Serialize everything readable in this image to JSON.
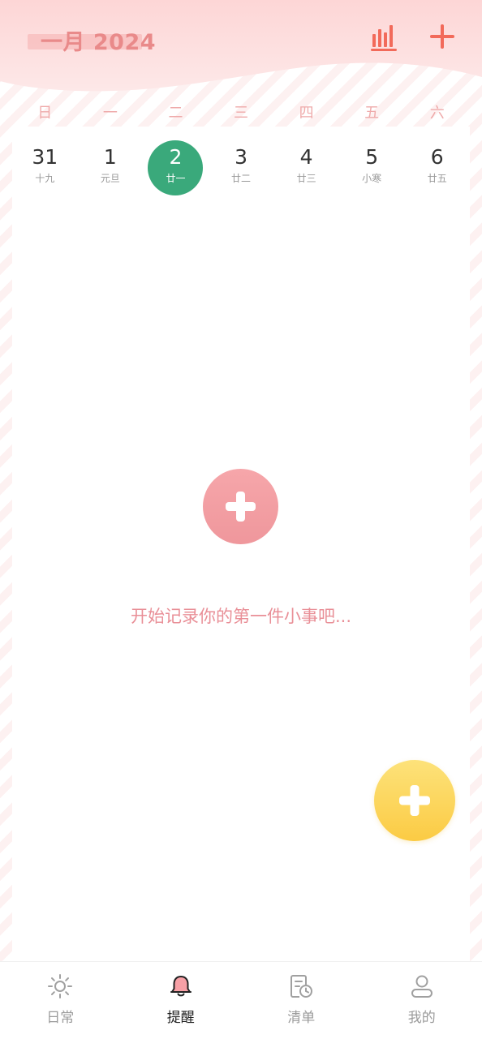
{
  "header": {
    "month_title": "一月 2024",
    "colors": {
      "accent": "#e98a8a",
      "icon": "#f26a5a",
      "wave": "#fde1e1"
    }
  },
  "weekdays": [
    "日",
    "一",
    "二",
    "三",
    "四",
    "五",
    "六"
  ],
  "dates": [
    {
      "day": "31",
      "lunar": "十九",
      "selected": false
    },
    {
      "day": "1",
      "lunar": "元旦",
      "selected": false
    },
    {
      "day": "2",
      "lunar": "廿一",
      "selected": true
    },
    {
      "day": "3",
      "lunar": "廿二",
      "selected": false
    },
    {
      "day": "4",
      "lunar": "廿三",
      "selected": false
    },
    {
      "day": "5",
      "lunar": "小寒",
      "selected": false
    },
    {
      "day": "6",
      "lunar": "廿五",
      "selected": false
    }
  ],
  "empty_state": {
    "message": "开始记录你的第一件小事吧...",
    "icon": "plus-icon",
    "color": "#f29fa4"
  },
  "fab": {
    "icon": "plus-icon",
    "color": "#fcd55a"
  },
  "tabbar": {
    "tabs": [
      {
        "label": "日常",
        "icon": "sun-icon",
        "active": false
      },
      {
        "label": "提醒",
        "icon": "bell-icon",
        "active": true
      },
      {
        "label": "清单",
        "icon": "list-clock-icon",
        "active": false
      },
      {
        "label": "我的",
        "icon": "user-icon",
        "active": false
      }
    ]
  }
}
